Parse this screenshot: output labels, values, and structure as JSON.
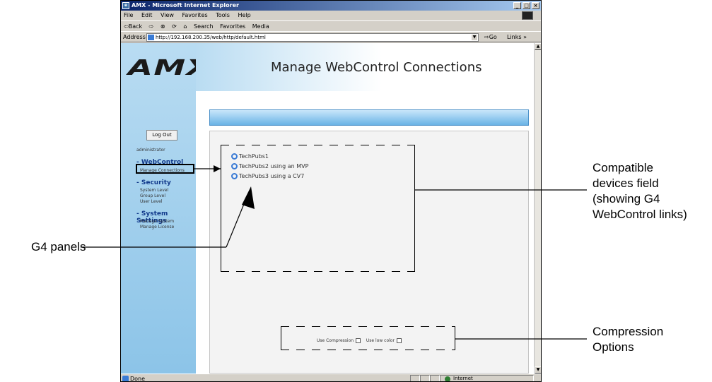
{
  "browser": {
    "title": "AMX - Microsoft Internet Explorer",
    "menu": [
      "File",
      "Edit",
      "View",
      "Favorites",
      "Tools",
      "Help"
    ],
    "toolbar": [
      "⇦Back",
      "⇨",
      "Search",
      "Favorites",
      "Media"
    ],
    "address_label": "Address",
    "address_value": "http://192.168.200.35/web/http/default.html",
    "go_label": "Go",
    "links_label": "Links",
    "status_text": "Done",
    "zone_text": "Internet"
  },
  "page": {
    "logo_text": "AMX",
    "title": "Manage WebControl Connections",
    "logout_label": "Log Out",
    "username": "administrator"
  },
  "nav": {
    "webcontrol": {
      "header": "- WebControl",
      "items": [
        "Manage Connections"
      ]
    },
    "security": {
      "header": "- Security",
      "items": [
        "System Level",
        "Group Level",
        "User Level"
      ]
    },
    "system_settings": {
      "header": "- System Settings",
      "items": [
        "Manage System",
        "Manage License"
      ]
    }
  },
  "devices": [
    "TechPubs1",
    "TechPubs2 using an MVP",
    "TechPubs3 using a CV7"
  ],
  "compression": {
    "use_compression_label": "Use Compression",
    "use_compression_checked": false,
    "low_color_label": "Use low color",
    "low_color_checked": false
  },
  "annotations": {
    "compatible_devices": [
      "Compatible",
      "devices field",
      "(showing G4",
      "WebControl links)"
    ],
    "g4_panels": "G4 panels",
    "compression_options": [
      "Compression",
      "Options"
    ]
  }
}
